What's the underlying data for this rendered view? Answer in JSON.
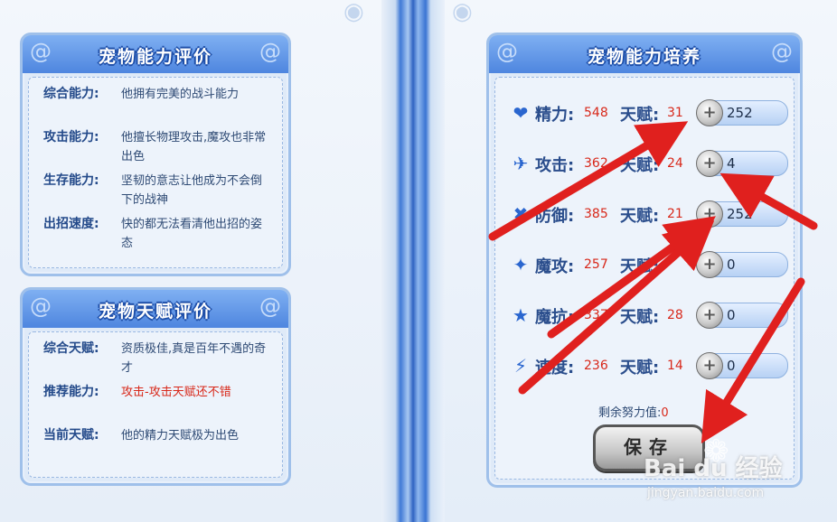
{
  "ability_eval": {
    "title": "宠物能力评价",
    "rows": [
      {
        "label": "综合能力:",
        "value": "他拥有完美的战斗能力"
      },
      {
        "label": "攻击能力:",
        "value": "他擅长物理攻击,魔攻也非常出色"
      },
      {
        "label": "生存能力:",
        "value": "坚韧的意志让他成为不会倒下的战神"
      },
      {
        "label": "出招速度:",
        "value": "快的都无法看清他出招的姿态"
      }
    ]
  },
  "talent_eval": {
    "title": "宠物天赋评价",
    "rows": [
      {
        "label": "综合天赋:",
        "value": "资质极佳,真是百年不遇的奇才",
        "color": "#2e4a74"
      },
      {
        "label": "推荐能力:",
        "value": "攻击-攻击天赋还不错",
        "color": "#d8281a"
      },
      {
        "label": "当前天赋:",
        "value": "他的精力天赋极为出色",
        "color": "#2e4a74"
      }
    ]
  },
  "training": {
    "title": "宠物能力培养",
    "talent_label": "天赋:",
    "stats": [
      {
        "icon": "heart-icon",
        "glyph": "❤",
        "name": "精力:",
        "value": "548",
        "talent": "31",
        "effort": "252"
      },
      {
        "icon": "sword-icon",
        "glyph": "✈",
        "name": "攻击:",
        "value": "362",
        "talent": "24",
        "effort": "4"
      },
      {
        "icon": "shield-cross-icon",
        "glyph": "✖",
        "name": "防御:",
        "value": "385",
        "talent": "21",
        "effort": "252"
      },
      {
        "icon": "magic-attack-icon",
        "glyph": "✦",
        "name": "魔攻:",
        "value": "257",
        "talent": "",
        "effort": "0"
      },
      {
        "icon": "magic-resist-icon",
        "glyph": "★",
        "name": "魔抗:",
        "value": "337",
        "talent": "28",
        "effort": "0"
      },
      {
        "icon": "lightning-icon",
        "glyph": "⚡",
        "name": "速度:",
        "value": "236",
        "talent": "14",
        "effort": "0"
      }
    ],
    "remaining_label": "剩余努力值:",
    "remaining_value": "0",
    "save_label": "保存"
  },
  "watermark": {
    "brand": "Bai du 经验",
    "url": "jingyan.baidu.com"
  },
  "colors": {
    "accent": "#4e86df",
    "value_red": "#d8281a",
    "arrow_red": "#e0201e"
  }
}
